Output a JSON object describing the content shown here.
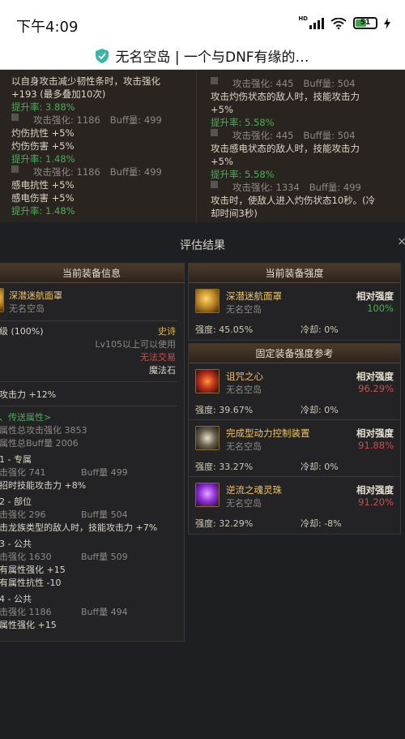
{
  "status_bar": {
    "time": "下午4:09",
    "hd_label": "HD",
    "battery": "51"
  },
  "title_bar": {
    "title": "无名空岛 | 一个与DNF有缘的…"
  },
  "background_list": {
    "left": [
      {
        "type": "text",
        "text": "以自身攻击减少韧性条时，攻击强化",
        "cls": "white"
      },
      {
        "type": "text",
        "text": "+193 (最多叠加10次)",
        "cls": "white"
      },
      {
        "type": "text",
        "text": "提升率: 3.88%",
        "cls": "green"
      },
      {
        "type": "row",
        "atk": "攻击强化: 1186",
        "buff": "Buff量: 499"
      },
      {
        "type": "text",
        "text": "灼伤抗性 +5%",
        "cls": "white"
      },
      {
        "type": "text",
        "text": "灼伤伤害 +5%",
        "cls": "white"
      },
      {
        "type": "text",
        "text": "提升率: 1.48%",
        "cls": "green"
      },
      {
        "type": "row",
        "atk": "攻击强化: 1186",
        "buff": "Buff量: 499"
      },
      {
        "type": "text",
        "text": "感电抗性 +5%",
        "cls": "white"
      },
      {
        "type": "text",
        "text": "感电伤害 +5%",
        "cls": "white"
      },
      {
        "type": "text",
        "text": "提升率: 1.48%",
        "cls": "green"
      }
    ],
    "right": [
      {
        "type": "row",
        "atk": "攻击强化: 445",
        "buff": "Buff量: 504"
      },
      {
        "type": "text",
        "text": "攻击灼伤状态的敌人时，技能攻击力",
        "cls": "white"
      },
      {
        "type": "text",
        "text": "+5%",
        "cls": "white"
      },
      {
        "type": "text",
        "text": "提升率: 5.58%",
        "cls": "green"
      },
      {
        "type": "row",
        "atk": "攻击强化: 445",
        "buff": "Buff量: 504"
      },
      {
        "type": "text",
        "text": "攻击感电状态的敌人时，技能攻击力",
        "cls": "white"
      },
      {
        "type": "text",
        "text": "+5%",
        "cls": "white"
      },
      {
        "type": "text",
        "text": "提升率: 5.58%",
        "cls": "green"
      },
      {
        "type": "row",
        "atk": "攻击强化: 1334",
        "buff": "Buff量: 499"
      },
      {
        "type": "text",
        "text": "攻击时，使敌人进入灼伤状态10秒。(冷",
        "cls": "white"
      },
      {
        "type": "text",
        "text": "却时间3秒)",
        "cls": "white"
      }
    ]
  },
  "modal": {
    "title": "评估结果",
    "close": "×",
    "left_panel": {
      "header": "当前装备信息",
      "item_name": "深潜迷航面罩",
      "item_source": "无名空岛",
      "grade": "级 (100%)",
      "rarity": "史诗",
      "level_req": "Lv105以上可以使用",
      "trade": "无法交易",
      "category": "魔法石",
      "base_stat": "攻击力 +12%",
      "section_title": "、传送属性>",
      "total_atk": "属性总攻击强化 3853",
      "total_buff": "属性总Buff量 2006",
      "groups": [
        {
          "title": "1 - 专属",
          "atk": "击强化  741",
          "buff": "Buff量  499",
          "effects": [
            "招时技能攻击力 +8%"
          ]
        },
        {
          "title": "2 - 部位",
          "atk": "击强化  296",
          "buff": "Buff量  504",
          "effects": [
            "击龙族类型的敌人时，技能攻击力 +7%"
          ]
        },
        {
          "title": "3 - 公共",
          "atk": "击强化  1630",
          "buff": "Buff量  509",
          "effects": [
            "有属性强化 +15",
            "有属性抗性 -10"
          ]
        },
        {
          "title": "4 - 公共",
          "atk": "击强化  1186",
          "buff": "Buff量  494",
          "effects": [
            "属性强化 +15"
          ]
        }
      ]
    },
    "current_strength": {
      "header": "当前装备强度",
      "items": [
        {
          "name": "深潜迷航面罩",
          "source": "无名空岛",
          "rel_label": "相对强度",
          "rel_value": "100%",
          "rel_color": "#4cae57",
          "strength": "强度: 45.05%",
          "cooldown": "冷却: 0%",
          "icon": "mask-icon",
          "icon_class": "ic-gold"
        }
      ]
    },
    "reference": {
      "header": "固定装备强度参考",
      "items": [
        {
          "name": "诅咒之心",
          "source": "无名空岛",
          "rel_label": "相对强度",
          "rel_value": "96.29%",
          "rel_color": "#d14b4b",
          "strength": "强度: 39.67%",
          "cooldown": "冷却: 0%",
          "icon": "cursed-heart-icon",
          "icon_class": "ic-red"
        },
        {
          "name": "完成型动力控制装置",
          "source": "无名空岛",
          "rel_label": "相对强度",
          "rel_value": "91.88%",
          "rel_color": "#d14b4b",
          "strength": "强度: 33.27%",
          "cooldown": "冷却: 0%",
          "icon": "power-control-icon",
          "icon_class": "ic-mech"
        },
        {
          "name": "逆流之魂灵珠",
          "source": "无名空岛",
          "rel_label": "相对强度",
          "rel_value": "91.20%",
          "rel_color": "#d14b4b",
          "strength": "强度: 32.29%",
          "cooldown": "冷却: -8%",
          "icon": "soul-orb-icon",
          "icon_class": "ic-purple"
        }
      ]
    }
  }
}
